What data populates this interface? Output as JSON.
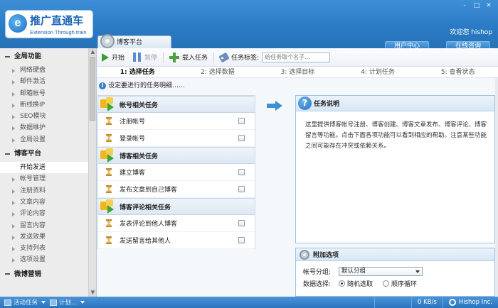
{
  "window": {
    "welcome": "欢迎您 hishop",
    "controls": [
      "-",
      "□",
      "✕"
    ]
  },
  "logo": {
    "mark": "e",
    "cn": "推广直通车",
    "en": "Extension Through train"
  },
  "top_tabs": {
    "active": "博客平台",
    "right": [
      "用户中心",
      "在线咨询"
    ]
  },
  "sidebar": {
    "groups": [
      {
        "label": "全局功能",
        "items": [
          "网络硬盘",
          "邮件激活",
          "邮箱帐号",
          "断线换IP",
          "SEO模块",
          "数据维护",
          "全局设置"
        ]
      },
      {
        "label": "博客平台",
        "items": [
          "开始发送",
          "帐号管理",
          "注册资料",
          "文章内容",
          "评论内容",
          "留言内容",
          "发送效果",
          "支持列表",
          "选项设置"
        ]
      },
      {
        "label": "微博营销",
        "items": []
      }
    ],
    "active_item": "开始发送"
  },
  "toolbar": {
    "start": "开始",
    "pause": "暂停",
    "load": "载入任务",
    "tag_label": "任务标签:",
    "tag_placeholder": "给任务取个名子..."
  },
  "steps": [
    {
      "label": "1: 选择任务",
      "active": true
    },
    {
      "label": "2: 选择数据",
      "active": false
    },
    {
      "label": "3: 选择目标",
      "active": false
    },
    {
      "label": "4: 计划任务",
      "active": false
    },
    {
      "label": "5: 查看状态",
      "active": false
    }
  ],
  "hint": "设定要进行的任务明细……",
  "task_sections": [
    {
      "title": "帐号相关任务",
      "tasks": [
        "注册帐号",
        "登录帐号"
      ]
    },
    {
      "title": "博客相关任务",
      "tasks": [
        "建立博客",
        "发布文章到自己博客"
      ]
    },
    {
      "title": "博客评论相关任务",
      "tasks": [
        "发表评论到他人博客",
        "发送留言给其他人"
      ]
    }
  ],
  "description": {
    "title": "任务说明",
    "body": "这里提供博客帐号注册、博客创建、博客文章发布、博客评论、博客留言等功能。点击下面各项功能可以看到相应的帮助。注意某些功能之间可能存在冲突或依赖关系。"
  },
  "extra_options": {
    "title": "附加选项",
    "group_label": "帐号分组:",
    "group_value": "默认分组",
    "select_label": "数据选择:",
    "radio_options": [
      "随机选取",
      "顺序循环"
    ],
    "radio_selected": 0
  },
  "statusbar": {
    "left": [
      "活动任务",
      "计划..."
    ],
    "speed": "0 KB/s",
    "brand": "Hishop Inc."
  }
}
